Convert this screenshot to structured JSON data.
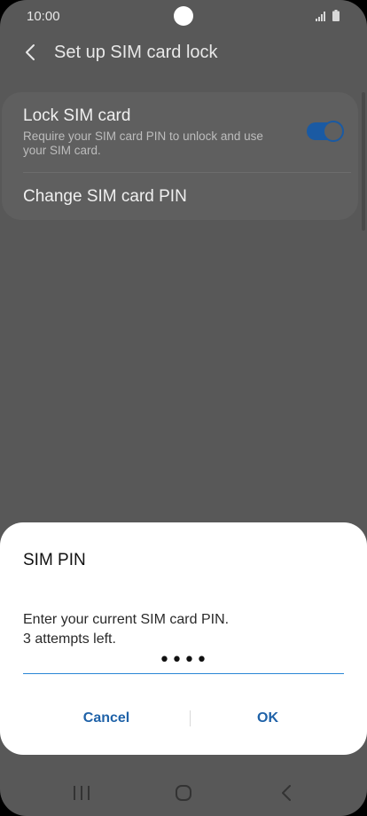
{
  "status_bar": {
    "time": "10:00"
  },
  "header": {
    "title": "Set up SIM card lock"
  },
  "settings": {
    "lock_sim": {
      "title": "Lock SIM card",
      "description": "Require your SIM card PIN to unlock and use your SIM card.",
      "enabled": true
    },
    "change_pin": {
      "title": "Change SIM card PIN"
    }
  },
  "dialog": {
    "title": "SIM PIN",
    "message_line1": "Enter your current SIM card PIN.",
    "message_line2": "3 attempts left.",
    "pin_value": "••••",
    "cancel_label": "Cancel",
    "ok_label": "OK"
  },
  "colors": {
    "accent": "#1f62a8",
    "toggle_on": "#1a5aa3",
    "input_underline": "#2a86d6"
  }
}
